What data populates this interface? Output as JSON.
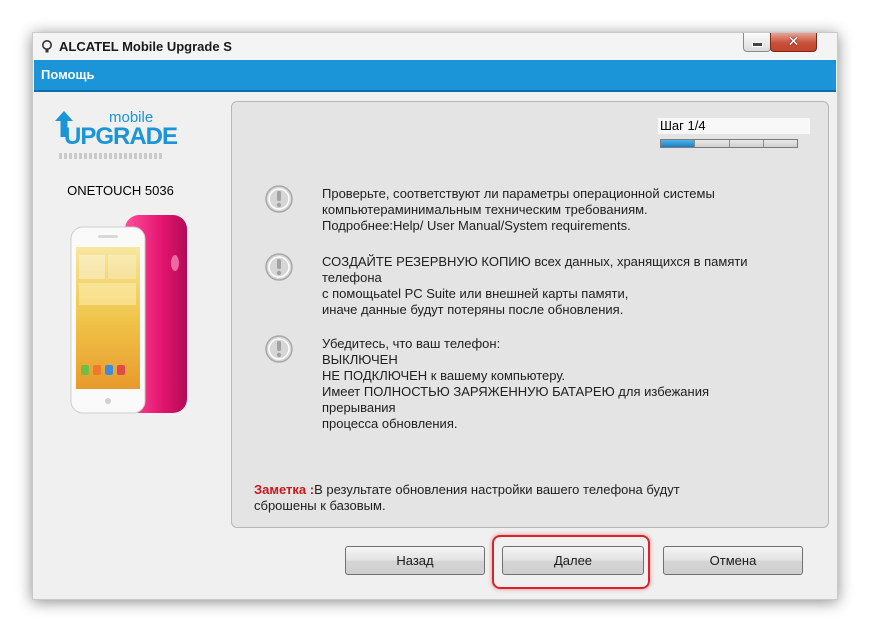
{
  "window": {
    "title": "ALCATEL Mobile Upgrade S",
    "close_glyph": "✕"
  },
  "help_bar": {
    "label": "Помощь"
  },
  "logo": {
    "top_word": "mobile",
    "main_word": "UPGRADE",
    "brand_color": "#1b95d8"
  },
  "device": {
    "name": "ONETOUCH 5036"
  },
  "step": {
    "label": "Шаг 1/4",
    "current": 1,
    "total": 4
  },
  "items": [
    {
      "icon": "exclamation-circle-icon",
      "lines": [
        "Проверьте, соответствуют ли параметры операционной системы",
        "компьютераминимальным техническим требованиям.",
        "Подробнее:Help/ User Manual/System requirements."
      ]
    },
    {
      "icon": "exclamation-circle-icon",
      "lines": [
        "СОЗДАЙТЕ РЕЗЕРВНУЮ КОПИЮ всех данных, хранящихся в памяти",
        "телефона",
        "с помощьatel PC Suite или внешней карты памяти,",
        "иначе данные будут потеряны после обновления."
      ]
    },
    {
      "icon": "exclamation-circle-icon",
      "lines": [
        "Убедитесь, что ваш телефон:",
        "ВЫКЛЮЧЕН",
        "НЕ ПОДКЛЮЧЕН к вашему компьютеру.",
        "Имеет ПОЛНОСТЬЮ ЗАРЯЖЕННУЮ БАТАРЕЮ для избежания",
        "прерывания",
        "процесса обновления."
      ]
    }
  ],
  "note": {
    "label": "Заметка :",
    "line1": "В результате обновления настройки вашего телефона будут",
    "line2": "сброшены к базовым.",
    "label_color": "#c8171d"
  },
  "buttons": {
    "back": "Назад",
    "next": "Далее",
    "cancel": "Отмена"
  },
  "highlight_color": "#d8232a"
}
